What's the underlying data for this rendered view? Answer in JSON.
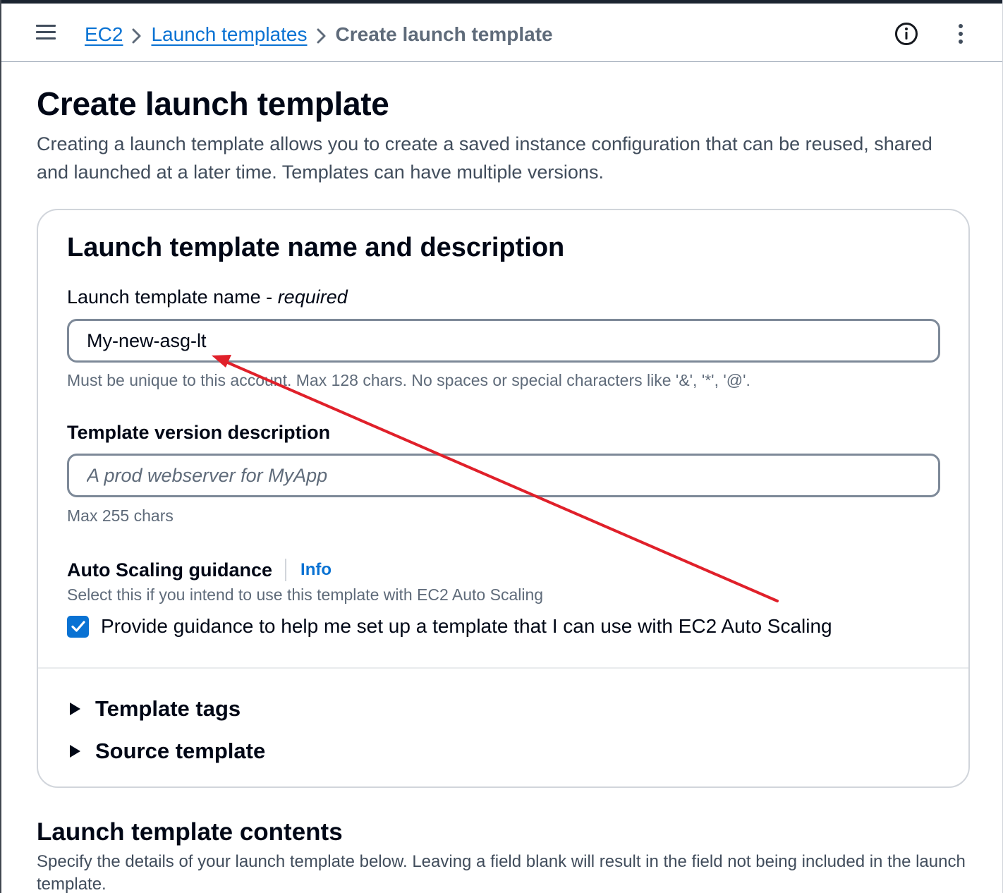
{
  "header": {
    "menu_icon": "hamburger-menu-icon",
    "breadcrumbs": [
      {
        "label": "EC2"
      },
      {
        "label": "Launch templates"
      },
      {
        "label": "Create launch template"
      }
    ],
    "info_icon": "info-circle-icon",
    "more_icon": "vertical-ellipsis-icon"
  },
  "page": {
    "title": "Create launch template",
    "description": "Creating a launch template allows you to create a saved instance configuration that can be reused, shared and launched at a later time. Templates can have multiple versions."
  },
  "name_section": {
    "title": "Launch template name and description",
    "name_label": "Launch template name - ",
    "name_label_required": "required",
    "name_value": "My-new-asg-lt",
    "name_hint": "Must be unique to this account. Max 128 chars. No spaces or special characters like '&', '*', '@'.",
    "desc_label": "Template version description",
    "desc_placeholder": "A prod webserver for MyApp",
    "desc_hint": "Max 255 chars",
    "guidance_label": "Auto Scaling guidance",
    "info_link": "Info",
    "guidance_hint": "Select this if you intend to use this template with EC2 Auto Scaling",
    "checkbox_label": "Provide guidance to help me set up a template that I can use with EC2 Auto Scaling",
    "checkbox_checked": true,
    "expanders": [
      {
        "label": "Template tags"
      },
      {
        "label": "Source template"
      }
    ]
  },
  "contents_section": {
    "title": "Launch template contents",
    "description": "Specify the details of your launch template below. Leaving a field blank will result in the field not being included in the launch template."
  },
  "colors": {
    "link": "#0972d3",
    "checkbox": "#0972d3",
    "annotation_arrow": "#e0202a"
  }
}
